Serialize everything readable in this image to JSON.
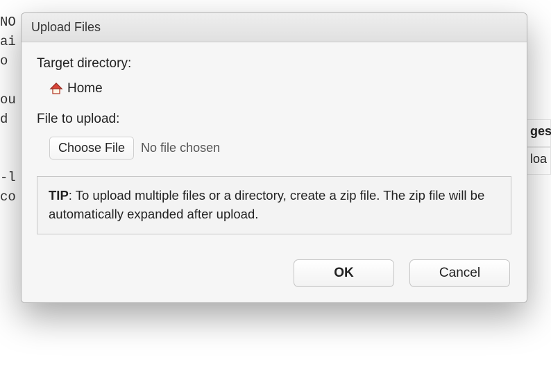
{
  "background_left_text": "NO\nai\no\n\nou\nd\n\n\n-l\nco",
  "background_right_header": "ges",
  "background_right_cell": "loa",
  "dialog": {
    "title": "Upload Files",
    "target_label": "Target directory:",
    "target_value": "Home",
    "file_label": "File to upload:",
    "choose_button": "Choose File",
    "no_file_text": "No file chosen",
    "tip_bold": "TIP",
    "tip_text": ": To upload multiple files or a directory, create a zip file. The zip file will be automatically expanded after upload.",
    "ok_label": "OK",
    "cancel_label": "Cancel"
  }
}
